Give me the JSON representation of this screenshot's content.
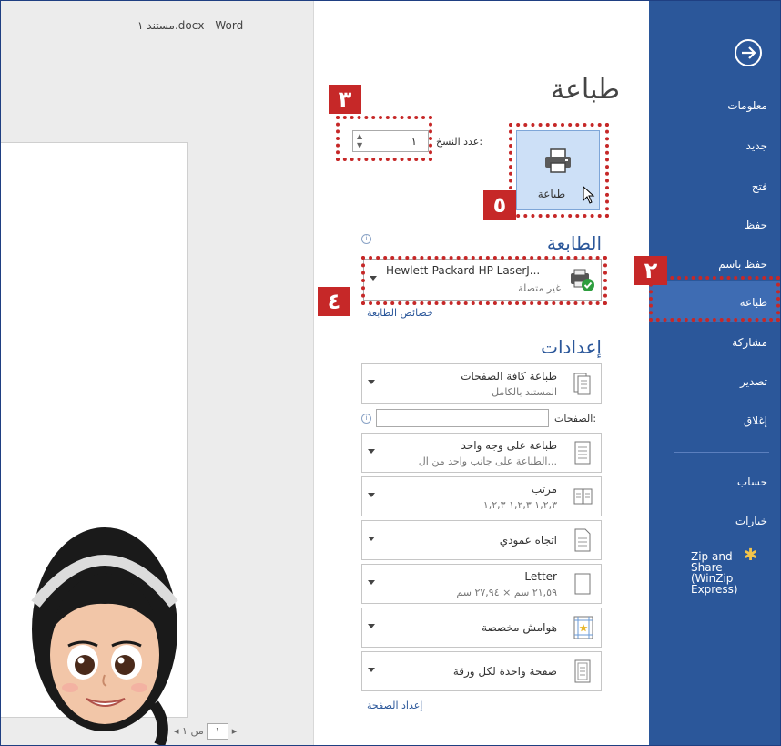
{
  "window": {
    "title": "مستند ١.docx - Word"
  },
  "sidebar": {
    "back_icon": "back-arrow-icon",
    "items": [
      {
        "label": "معلومات"
      },
      {
        "label": "جديد"
      },
      {
        "label": "فتح"
      },
      {
        "label": "حفظ"
      },
      {
        "label": "حفظ باسم"
      },
      {
        "label": "طباعة"
      },
      {
        "label": "مشاركة"
      },
      {
        "label": "تصدير"
      },
      {
        "label": "إغلاق"
      },
      {
        "label": "حساب"
      },
      {
        "label": "خيارات"
      }
    ],
    "zip": {
      "line1": "Zip and",
      "line2": "Share",
      "line3": "(WinZip",
      "line4": "Express)"
    },
    "bg_color": "#2b579a"
  },
  "print": {
    "title": "طباعة",
    "button_label": "طباعة",
    "copies_label": "عدد النسخ:",
    "copies_value": "١"
  },
  "printer": {
    "section_title": "الطابعة",
    "name": "Hewlett-Packard HP LaserJ...",
    "status": "غير متصلة",
    "properties_link": "خصائص الطابعة"
  },
  "settings": {
    "section_title": "إعدادات",
    "pages_label": "الصفحات:",
    "page_setup_link": "إعداد الصفحة",
    "items": [
      {
        "line1": "طباعة كافة الصفحات",
        "line2": "المستند بالكامل"
      },
      {
        "line1": "طباعة على وجه واحد",
        "line2": "الطباعة على جانب واحد من ال..."
      },
      {
        "line1": "مرتب",
        "line2": "١,٢,٣   ١,٢,٣   ١,٢,٣"
      },
      {
        "line1": "اتجاه عمودي"
      },
      {
        "line1": "Letter",
        "line2": "٢١,٥٩ سم × ٢٧,٩٤ سم"
      },
      {
        "line1": "هوامش مخصصة"
      },
      {
        "line1": "صفحة واحدة لكل ورقة"
      }
    ]
  },
  "preview": {
    "page_current": "١",
    "of_label": "من ١"
  },
  "annotations": {
    "color": "#c62828",
    "badges": [
      "٢",
      "٣",
      "٤",
      "٥"
    ]
  }
}
